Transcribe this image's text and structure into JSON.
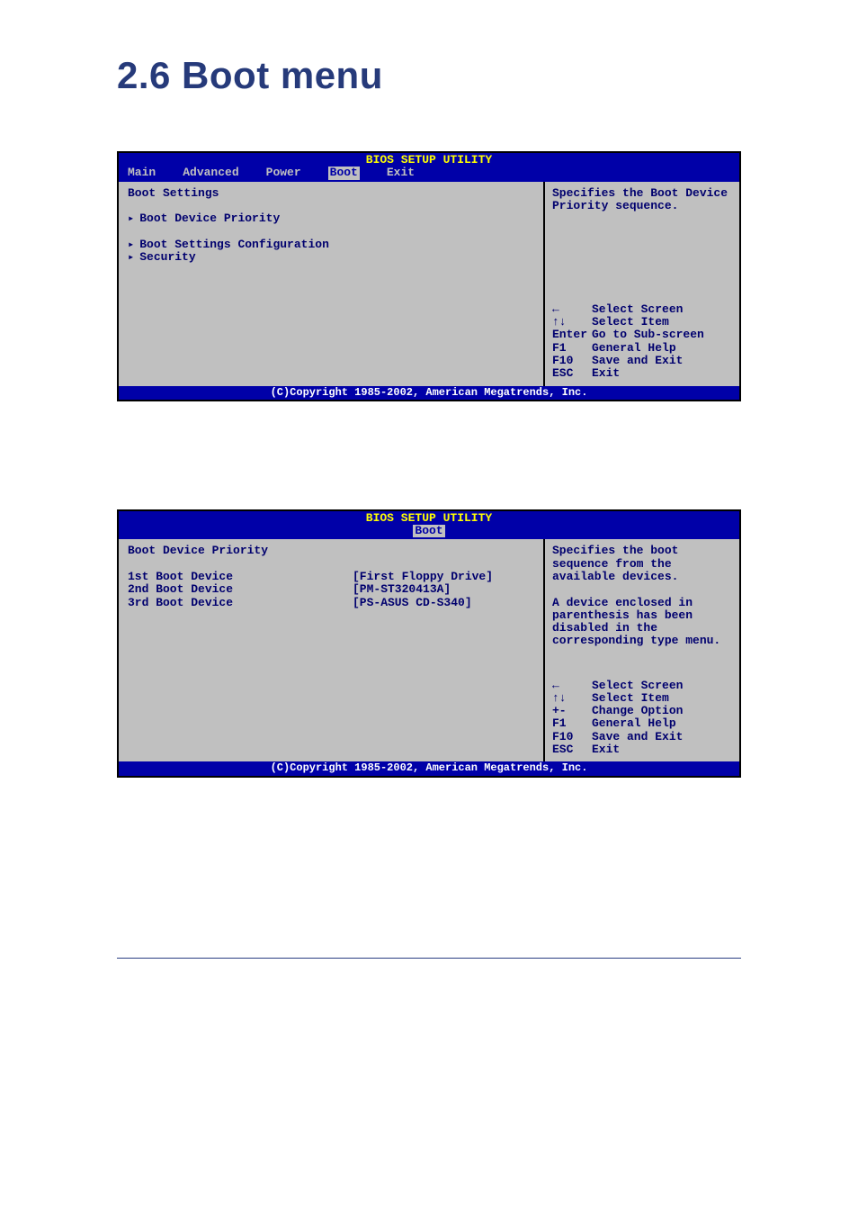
{
  "page": {
    "heading": "2.6   Boot menu"
  },
  "bios1": {
    "title": "BIOS SETUP UTILITY",
    "tabs": {
      "main": "Main",
      "advanced": "Advanced",
      "power": "Power",
      "boot": "Boot",
      "exit": "Exit"
    },
    "section_header": "Boot Settings",
    "items": {
      "boot_device_priority": "Boot Device Priority",
      "boot_settings_config": "Boot Settings Configuration",
      "security": "Security"
    },
    "help_text": "Specifies the Boot Device Priority sequence.",
    "keys": {
      "left": {
        "icon": "←",
        "label": "Select Screen"
      },
      "updown": {
        "icon": "↑↓",
        "label": "Select Item"
      },
      "enter": {
        "icon": "Enter",
        "label": "Go to Sub-screen"
      },
      "f1": {
        "icon": "F1",
        "label": "General Help"
      },
      "f10": {
        "icon": "F10",
        "label": "Save and Exit"
      },
      "esc": {
        "icon": "ESC",
        "label": "Exit"
      }
    },
    "footer": "(C)Copyright 1985-2002, American Megatrends, Inc."
  },
  "bios2": {
    "title": "BIOS SETUP UTILITY",
    "active_tab": "Boot",
    "section_header": "Boot Device Priority",
    "boot_rows": [
      {
        "label": "1st Boot Device",
        "value": "[First Floppy Drive]"
      },
      {
        "label": "2nd Boot Device",
        "value": "[PM-ST320413A]"
      },
      {
        "label": "3rd Boot Device",
        "value": "[PS-ASUS CD-S340]"
      }
    ],
    "help_text_top": "Specifies the boot sequence from the available devices.",
    "help_text_mid": "A device enclosed in parenthesis has been disabled in the corresponding type menu.",
    "keys": {
      "left": {
        "icon": "←",
        "label": "Select Screen"
      },
      "updown": {
        "icon": "↑↓",
        "label": "Select Item"
      },
      "plusminus": {
        "icon": "+-",
        "label": "Change Option"
      },
      "f1": {
        "icon": "F1",
        "label": "General Help"
      },
      "f10": {
        "icon": "F10",
        "label": "Save and Exit"
      },
      "esc": {
        "icon": "ESC",
        "label": "Exit"
      }
    },
    "footer": "(C)Copyright 1985-2002, American Megatrends, Inc."
  }
}
